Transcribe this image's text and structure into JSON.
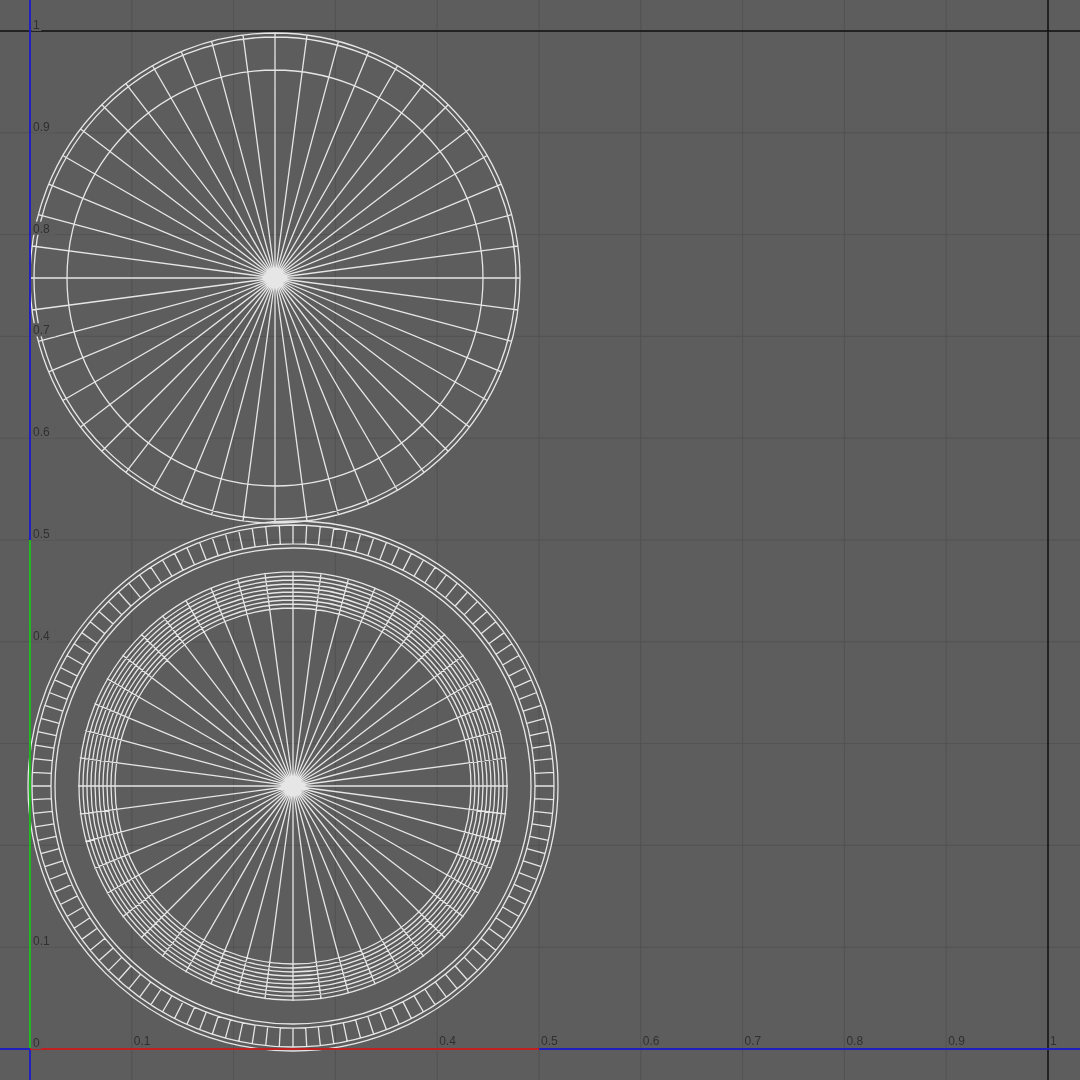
{
  "uv_editor": {
    "v_axis_labels": [
      "1",
      "0.9",
      "0.8",
      "0.7",
      "0.6",
      "0.5",
      "0.4",
      "0.1",
      "0"
    ],
    "u_axis_labels": [
      "0.1",
      "0.4",
      "0.5",
      "0.6",
      "0.7",
      "0.8",
      "0.9",
      "1"
    ]
  }
}
